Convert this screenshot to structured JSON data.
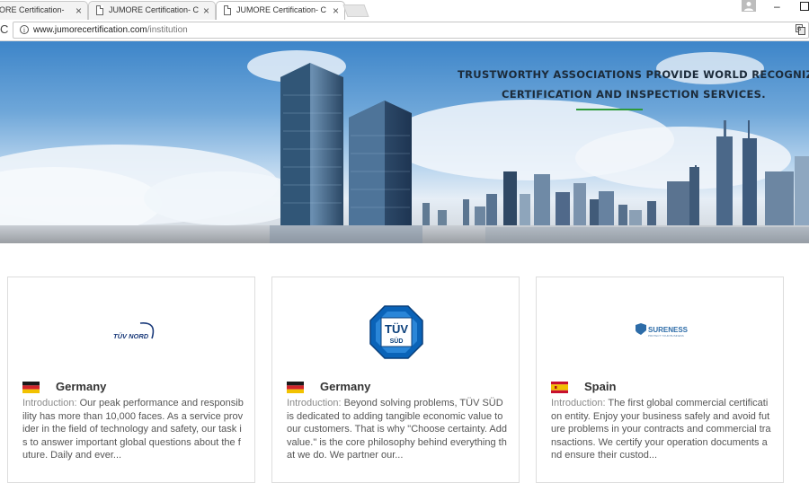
{
  "browser": {
    "tabs": [
      {
        "title": "ORE Certification- C",
        "active": false
      },
      {
        "title": "JUMORE Certification- C",
        "active": false
      },
      {
        "title": "JUMORE Certification- C",
        "active": true
      }
    ],
    "close_glyph": "×",
    "url_host": "www.jumorecertification.com",
    "url_path": "/institution"
  },
  "banner": {
    "line1": "TRUSTWORTHY ASSOCIATIONS PROVIDE WORLD RECOGNIZED",
    "line2": "CERTIFICATION AND INSPECTION SERVICES.",
    "accent_color": "#2e9a3a"
  },
  "cards": [
    {
      "logo": "tuv-nord-logo",
      "logo_text": "TÜV NORD",
      "country": "Germany",
      "flag": "germany-flag",
      "intro_label": "Introduction:",
      "intro_text": " Our peak performance and responsibility has more than 10,000 faces. As a service provider in the field of technology and safety, our task is to answer important global questions about the future. Daily and ever..."
    },
    {
      "logo": "tuv-sud-logo",
      "logo_text_top": "TÜV",
      "logo_text_bottom": "SÜD",
      "country": "Germany",
      "flag": "germany-flag",
      "intro_label": "Introduction:",
      "intro_text": " Beyond solving problems, TÜV SÜD is dedicated to adding tangible economic value to our customers. That is why \"Choose certainty. Add value.\" is the core philosophy behind everything that we do. We partner our..."
    },
    {
      "logo": "sureness-logo",
      "logo_text": "SURENESS",
      "logo_tagline": "PROTECT YOUR BUSINESS",
      "country": "Spain",
      "flag": "spain-flag",
      "intro_label": "Introduction:",
      "intro_text": " The first global commercial certification entity. Enjoy your business safely and avoid future problems in your contracts and commercial transactions. We certify your operation documents and ensure their custod..."
    }
  ]
}
